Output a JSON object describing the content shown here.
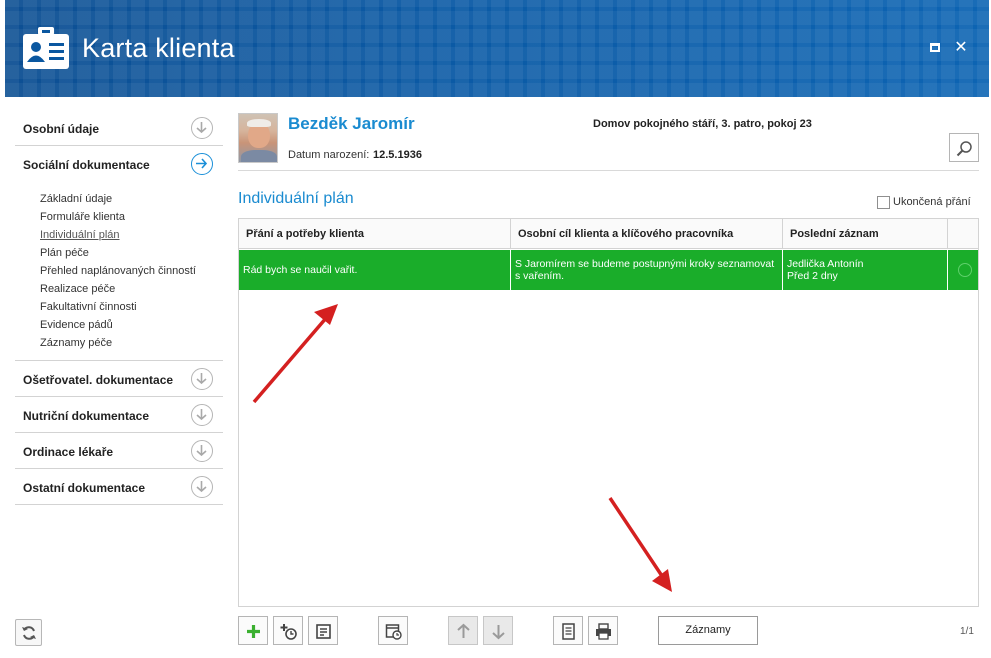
{
  "window": {
    "title": "Karta klienta",
    "icon": "id-card-icon"
  },
  "sidebar": {
    "sections": [
      {
        "label": "Osobní údaje",
        "icon": "chevron-down-circle-icon"
      },
      {
        "label": "Sociální dokumentace",
        "icon": "chevron-right-circle-icon"
      },
      {
        "label": "Ošetřovatel. dokumentace",
        "icon": "chevron-down-circle-icon"
      },
      {
        "label": "Nutriční dokumentace",
        "icon": "chevron-down-circle-icon"
      },
      {
        "label": "Ordinace lékaře",
        "icon": "chevron-down-circle-icon"
      },
      {
        "label": "Ostatní dokumentace",
        "icon": "chevron-down-circle-icon"
      }
    ],
    "social_items": [
      "Základní údaje",
      "Formuláře klienta",
      "Individuální plán",
      "Plán péče",
      "Přehled naplánovaných činností",
      "Realizace péče",
      "Fakultativní činnosti",
      "Evidence pádů",
      "Záznamy péče"
    ]
  },
  "client": {
    "name": "Bezděk Jaromír",
    "dob_label": "Datum narození:",
    "dob": "12.5.1936",
    "location": "Domov pokojného stáří, 3. patro, pokoj 23"
  },
  "plan": {
    "title": "Individuální plán",
    "finished_label": "Ukončená přání",
    "finished_checked": false,
    "columns": [
      "Přání a potřeby klienta",
      "Osobní cíl klienta a klíčového pracovníka",
      "Poslední záznam"
    ],
    "rows": [
      {
        "wish": "Rád bych se naučil vařit.",
        "goal_line1": "S Jaromírem se budeme postupnými kroky seznamovat",
        "goal_line2": "s vařením.",
        "last_author": "Jedlička Antonín",
        "last_when": "Před 2 dny",
        "highlight": "#1aad2a"
      }
    ]
  },
  "toolbar": {
    "records_label": "Záznamy",
    "pager": "1/1",
    "icons": [
      "add-icon",
      "add-timed-record-icon",
      "note-icon",
      "calendar-clock-icon",
      "arrow-up-icon",
      "arrow-down-icon",
      "document-icon",
      "print-icon"
    ]
  },
  "colors": {
    "header": "#0a57a0",
    "accent": "#1a8bd0",
    "row_highlight": "#1aad2a",
    "annotation_arrow": "#d42020"
  }
}
